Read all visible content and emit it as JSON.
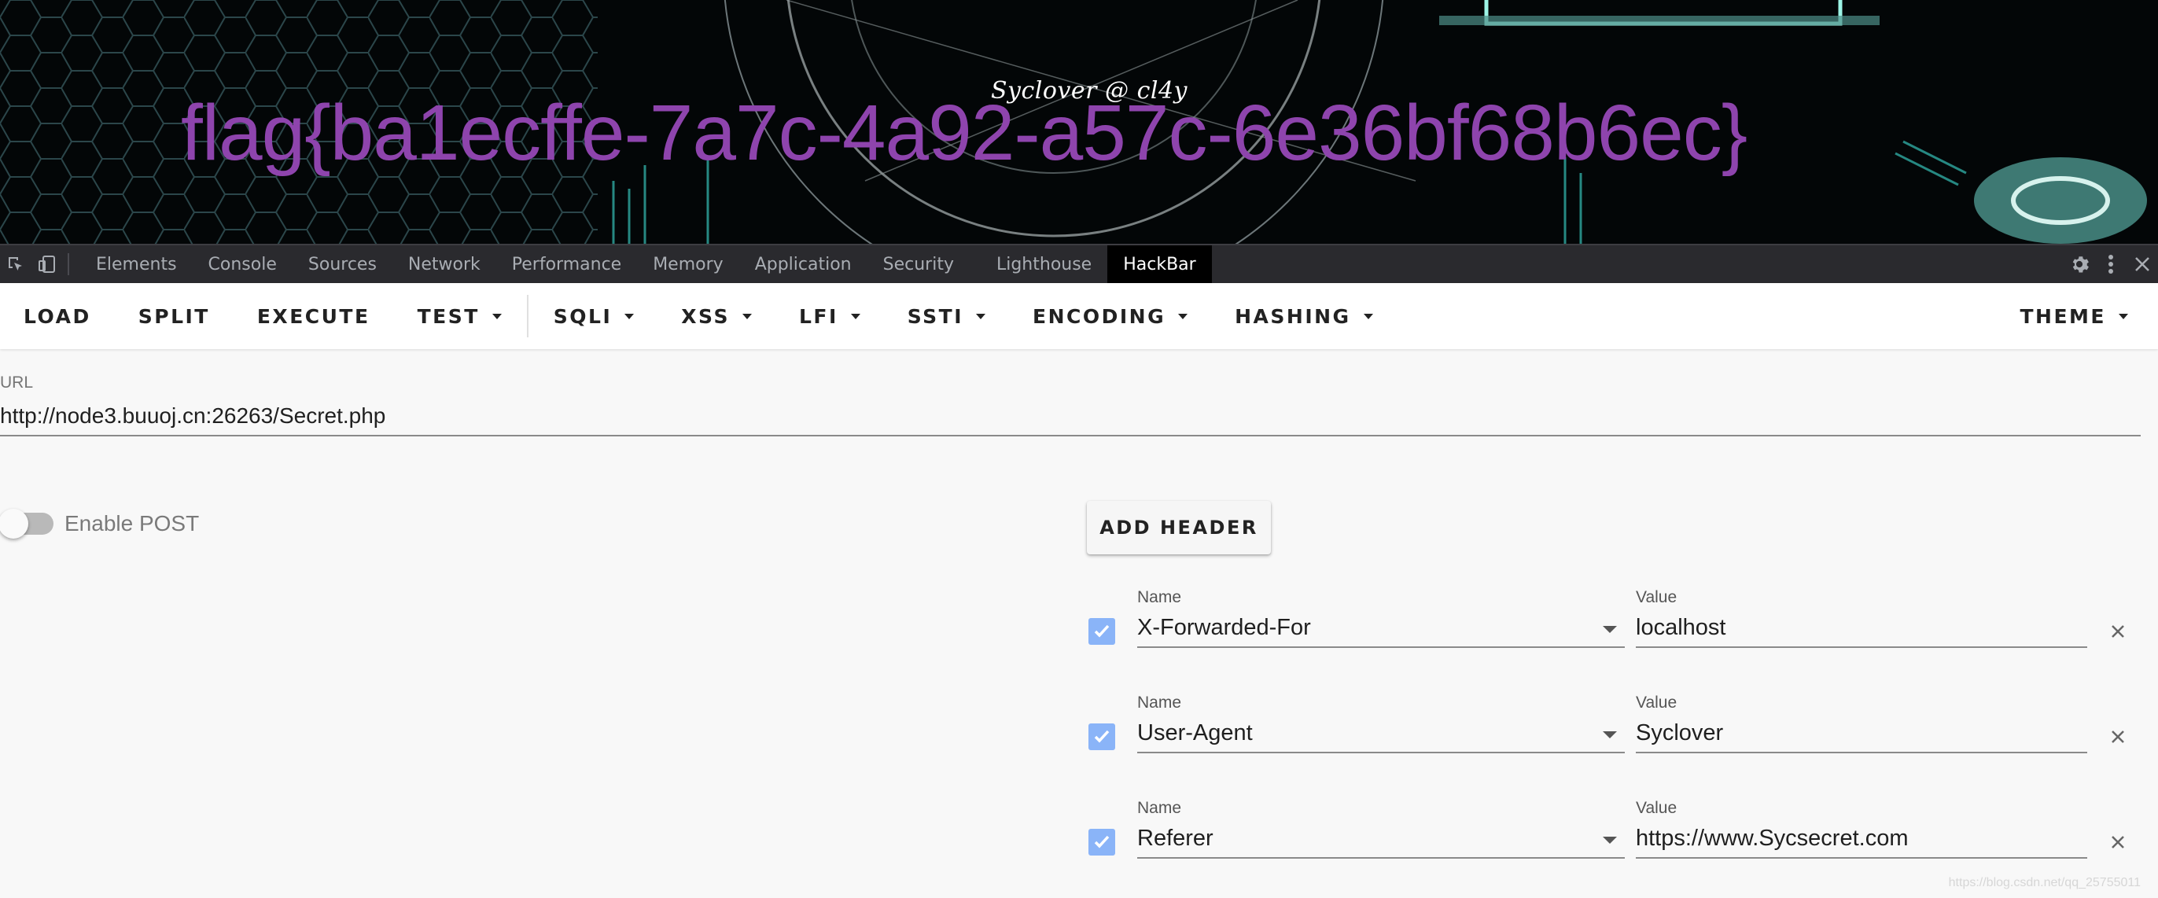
{
  "banner": {
    "subtitle": "Syclover @ cl4y",
    "flag": "flag{ba1ecffe-7a7c-4a92-a57c-6e36bf68b6ec}"
  },
  "devtools": {
    "tabs": [
      "Elements",
      "Console",
      "Sources",
      "Network",
      "Performance",
      "Memory",
      "Application",
      "Security",
      "Lighthouse",
      "HackBar"
    ],
    "active_tab": "HackBar"
  },
  "hackbar": {
    "buttons": {
      "load": "LOAD",
      "split": "SPLIT",
      "execute": "EXECUTE",
      "test": "TEST",
      "sqli": "SQLI",
      "xss": "XSS",
      "lfi": "LFI",
      "ssti": "SSTI",
      "encoding": "ENCODING",
      "hashing": "HASHING",
      "theme": "THEME"
    },
    "url_label": "URL",
    "url_value": "http://node3.buuoj.cn:26263/Secret.php",
    "enable_post_label": "Enable POST",
    "enable_post": false,
    "add_header_label": "ADD HEADER",
    "headers": [
      {
        "name_label": "Name",
        "name": "X-Forwarded-For",
        "value_label": "Value",
        "value": "localhost",
        "checked": true
      },
      {
        "name_label": "Name",
        "name": "User-Agent",
        "value_label": "Value",
        "value": "Syclover",
        "checked": true
      },
      {
        "name_label": "Name",
        "name": "Referer",
        "value_label": "Value",
        "value": "https://www.Sycsecret.com",
        "checked": true
      }
    ]
  },
  "watermark": "https://blog.csdn.net/qq_25755011",
  "colors": {
    "flag": "#8e44ad",
    "checkbox": "#8ab4f8",
    "devtools_bg": "#2a2a2e"
  }
}
